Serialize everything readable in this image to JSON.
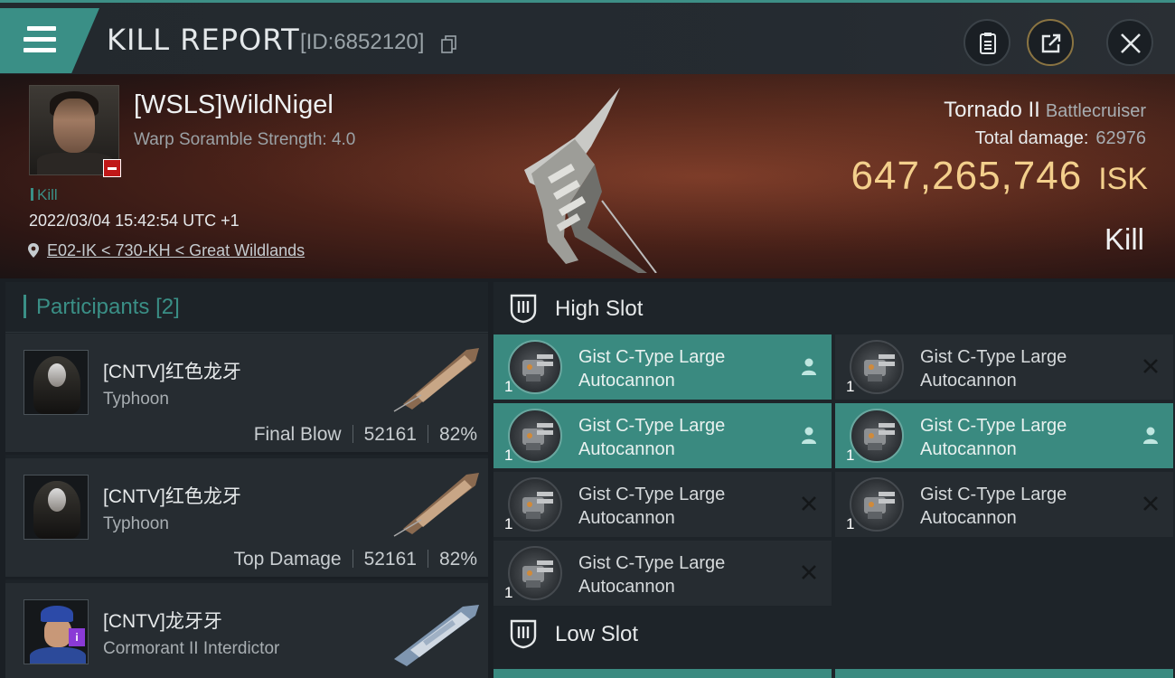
{
  "header": {
    "title": "KILL REPORT",
    "report_id": "[ID:6852120]"
  },
  "victim": {
    "name": "[WSLS]WildNigel",
    "warp_scramble": "Warp Soramble Strength: 4.0",
    "tag": "Kill",
    "datetime": "2022/03/04 15:42:54 UTC +1",
    "location": "E02-IK < 730-KH < Great Wildlands",
    "ship_name": "Tornado II",
    "ship_class": "Battlecruiser",
    "total_damage_label": "Total damage:",
    "total_damage": "62976",
    "isk_value": "647,265,746",
    "isk_unit": "ISK",
    "result": "Kill"
  },
  "participants": {
    "title": "Participants",
    "count": "[2]",
    "rows": [
      {
        "name": "[CNTV]红色龙牙",
        "ship": "Typhoon",
        "role": "Final Blow",
        "damage": "52161",
        "percent": "82%"
      },
      {
        "name": "[CNTV]红色龙牙",
        "ship": "Typhoon",
        "role": "Top Damage",
        "damage": "52161",
        "percent": "82%"
      },
      {
        "name": "[CNTV]龙牙牙",
        "ship": "Cormorant II Interdictor"
      }
    ]
  },
  "slots": {
    "high_title": "High Slot",
    "low_title": "Low Slot",
    "high": [
      {
        "line1": "Gist C-Type Large",
        "line2": "Autocannon",
        "qty": "1",
        "state": "fitted"
      },
      {
        "line1": "Gist C-Type Large",
        "line2": "Autocannon",
        "qty": "1",
        "state": "destroyed"
      },
      {
        "line1": "Gist C-Type Large",
        "line2": "Autocannon",
        "qty": "1",
        "state": "fitted"
      },
      {
        "line1": "Gist C-Type Large",
        "line2": "Autocannon",
        "qty": "1",
        "state": "fitted"
      },
      {
        "line1": "Gist C-Type Large",
        "line2": "Autocannon",
        "qty": "1",
        "state": "destroyed"
      },
      {
        "line1": "Gist C-Type Large",
        "line2": "Autocannon",
        "qty": "1",
        "state": "destroyed"
      },
      {
        "line1": "Gist C-Type Large",
        "line2": "Autocannon",
        "qty": "1",
        "state": "destroyed"
      }
    ]
  },
  "colors": {
    "accent": "#3a8f86",
    "isk": "#f3cf8c",
    "fitted_slot": "#3a8a80",
    "empty_slot": "#262c31",
    "danger": "#c01818"
  },
  "icons": [
    "menu-icon",
    "copy-icon",
    "clipboard-icon",
    "share-icon",
    "close-icon",
    "location-pin-icon",
    "person-icon",
    "x-icon",
    "slot-icon"
  ]
}
